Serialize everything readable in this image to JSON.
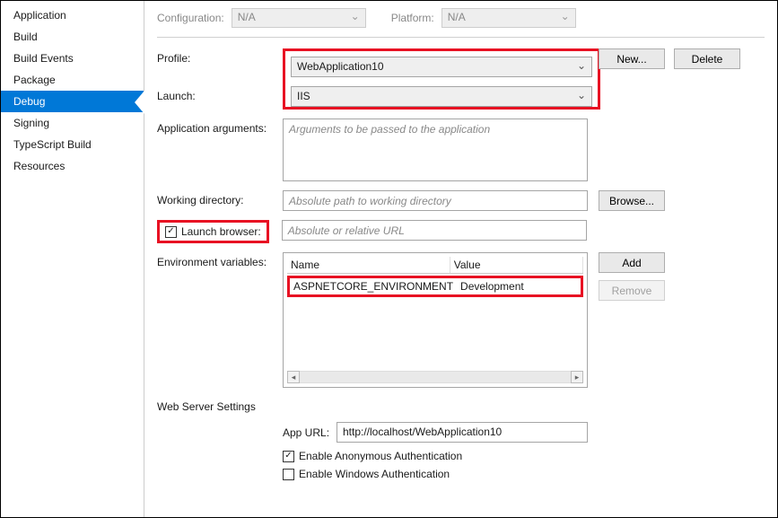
{
  "sidebar": {
    "items": [
      {
        "label": "Application"
      },
      {
        "label": "Build"
      },
      {
        "label": "Build Events"
      },
      {
        "label": "Package"
      },
      {
        "label": "Debug"
      },
      {
        "label": "Signing"
      },
      {
        "label": "TypeScript Build"
      },
      {
        "label": "Resources"
      }
    ]
  },
  "config": {
    "configuration_label": "Configuration:",
    "configuration_value": "N/A",
    "platform_label": "Platform:",
    "platform_value": "N/A"
  },
  "form": {
    "profile_label": "Profile:",
    "profile_value": "WebApplication10",
    "new_button": "New...",
    "delete_button": "Delete",
    "launch_label": "Launch:",
    "launch_value": "IIS",
    "app_args_label": "Application arguments:",
    "app_args_placeholder": "Arguments to be passed to the application",
    "workdir_label": "Working directory:",
    "workdir_placeholder": "Absolute path to working directory",
    "browse_button": "Browse...",
    "launch_browser_label": "Launch browser:",
    "launch_browser_checked": true,
    "launch_browser_placeholder": "Absolute or relative URL",
    "envvars_label": "Environment variables:",
    "env_headers": {
      "name": "Name",
      "value": "Value"
    },
    "env_rows": [
      {
        "name": "ASPNETCORE_ENVIRONMENT",
        "value": "Development"
      }
    ],
    "add_button": "Add",
    "remove_button": "Remove",
    "webserver_title": "Web Server Settings",
    "app_url_label": "App URL:",
    "app_url_value": "http://localhost/WebApplication10",
    "anon_auth_label": "Enable Anonymous Authentication",
    "anon_auth_checked": true,
    "win_auth_label": "Enable Windows Authentication",
    "win_auth_checked": false
  }
}
